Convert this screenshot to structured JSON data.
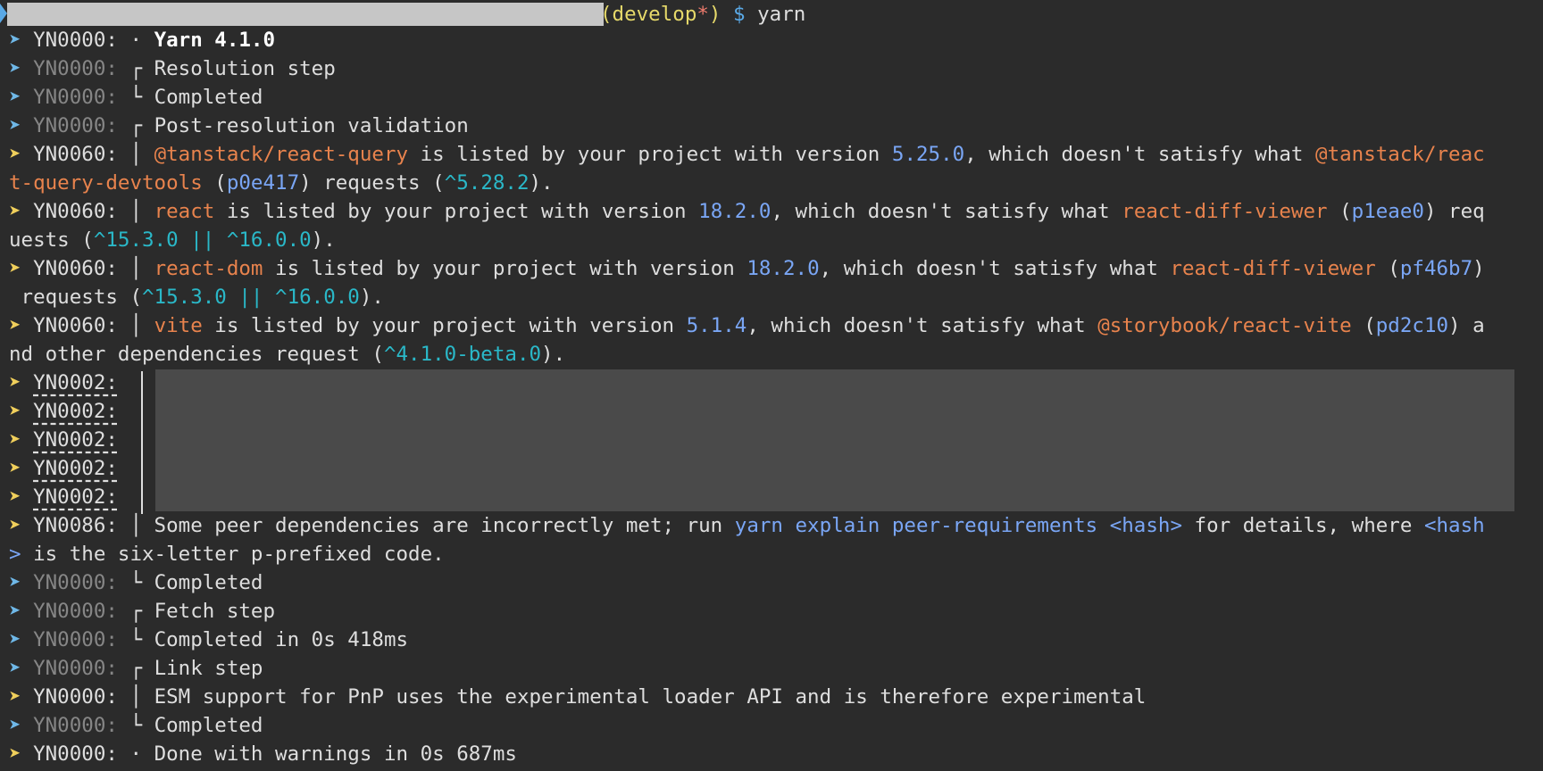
{
  "prompt": {
    "branch": "(develop",
    "branch_dirty": "*",
    "branch_close": ")",
    "symbol": "$",
    "command": "yarn"
  },
  "lines": {
    "l1_tag": "YN0000:",
    "l1_sep": "·",
    "l1_text": "Yarn 4.1.0",
    "l2_tag": "YN0000:",
    "l2_sep": "┌",
    "l2_text": "Resolution step",
    "l3_tag": "YN0000:",
    "l3_sep": "└",
    "l3_text": "Completed",
    "l4_tag": "YN0000:",
    "l4_sep": "┌",
    "l4_text": "Post-resolution validation",
    "w1": {
      "tag": "YN0060:",
      "sep": "│",
      "pkg": "@tanstack/react-query",
      "t1": " is listed by your project with version ",
      "ver": "5.25.0",
      "t2": ", which doesn't satisfy what ",
      "dep_a": "@tanstack/reac",
      "dep_b": "t-query-devtools",
      "t3": " (",
      "hash": "p0e417",
      "t4": ") requests (",
      "range": "^5.28.2",
      "t5": ")."
    },
    "w2": {
      "tag": "YN0060:",
      "sep": "│",
      "pkg": "react",
      "t1": " is listed by your project with version ",
      "ver": "18.2.0",
      "t2": ", which doesn't satisfy what ",
      "dep": "react-diff-viewer",
      "t3": " (",
      "hash": "p1eae0",
      "t4": ") req",
      "t5": "uests (",
      "range": "^15.3.0 || ^16.0.0",
      "t6": ")."
    },
    "w3": {
      "tag": "YN0060:",
      "sep": "│",
      "pkg": "react-dom",
      "t1": " is listed by your project with version ",
      "ver": "18.2.0",
      "t2": ", which doesn't satisfy what ",
      "dep": "react-diff-viewer",
      "t3": " (",
      "hash": "pf46b7",
      "t4": ")",
      "t5": " requests (",
      "range": "^15.3.0 || ^16.0.0",
      "t6": ")."
    },
    "w4": {
      "tag": "YN0060:",
      "sep": "│",
      "pkg": "vite",
      "t1": " is listed by your project with version ",
      "ver": "5.1.4",
      "t2": ", which doesn't satisfy what ",
      "dep": "@storybook/react-vite",
      "t3": " (",
      "hash": "pd2c10",
      "t4": ") a",
      "t5": "nd other dependencies request (",
      "range": "^4.1.0-beta.0",
      "t6": ")."
    },
    "n2_tag": "YN0002:",
    "n86": {
      "tag": "YN0086:",
      "sep": "│",
      "t1": " Some peer dependencies are incorrectly met; run ",
      "cmd": "yarn explain peer-requirements <hash>",
      "t2": " for details, where ",
      "h1": "<hash",
      "h2": ">",
      "t3": " is the six-letter p-prefixed code."
    },
    "l15_tag": "YN0000:",
    "l15_sep": "└",
    "l15_text": "Completed",
    "l16_tag": "YN0000:",
    "l16_sep": "┌",
    "l16_text": "Fetch step",
    "l17_tag": "YN0000:",
    "l17_sep": "└",
    "l17_text": "Completed in 0s 418ms",
    "l18_tag": "YN0000:",
    "l18_sep": "┌",
    "l18_text": "Link step",
    "l19_tag": "YN0000:",
    "l19_sep": "│",
    "l19_text": "ESM support for PnP uses the experimental loader API and is therefore experimental",
    "l20_tag": "YN0000:",
    "l20_sep": "└",
    "l20_text": "Completed",
    "l21_tag": "YN0000:",
    "l21_sep": "·",
    "l21_text": "Done with warnings in 0s 687ms"
  },
  "glyphs": {
    "arrow": "➤"
  },
  "colors": {
    "background": "#2b2b2b",
    "info_arrow": "#6fb8e8",
    "warn_arrow": "#f0cf5b",
    "package": "#e8834d",
    "version": "#7aa6f5",
    "range": "#2ab8c8",
    "branch": "#e6d96a"
  }
}
